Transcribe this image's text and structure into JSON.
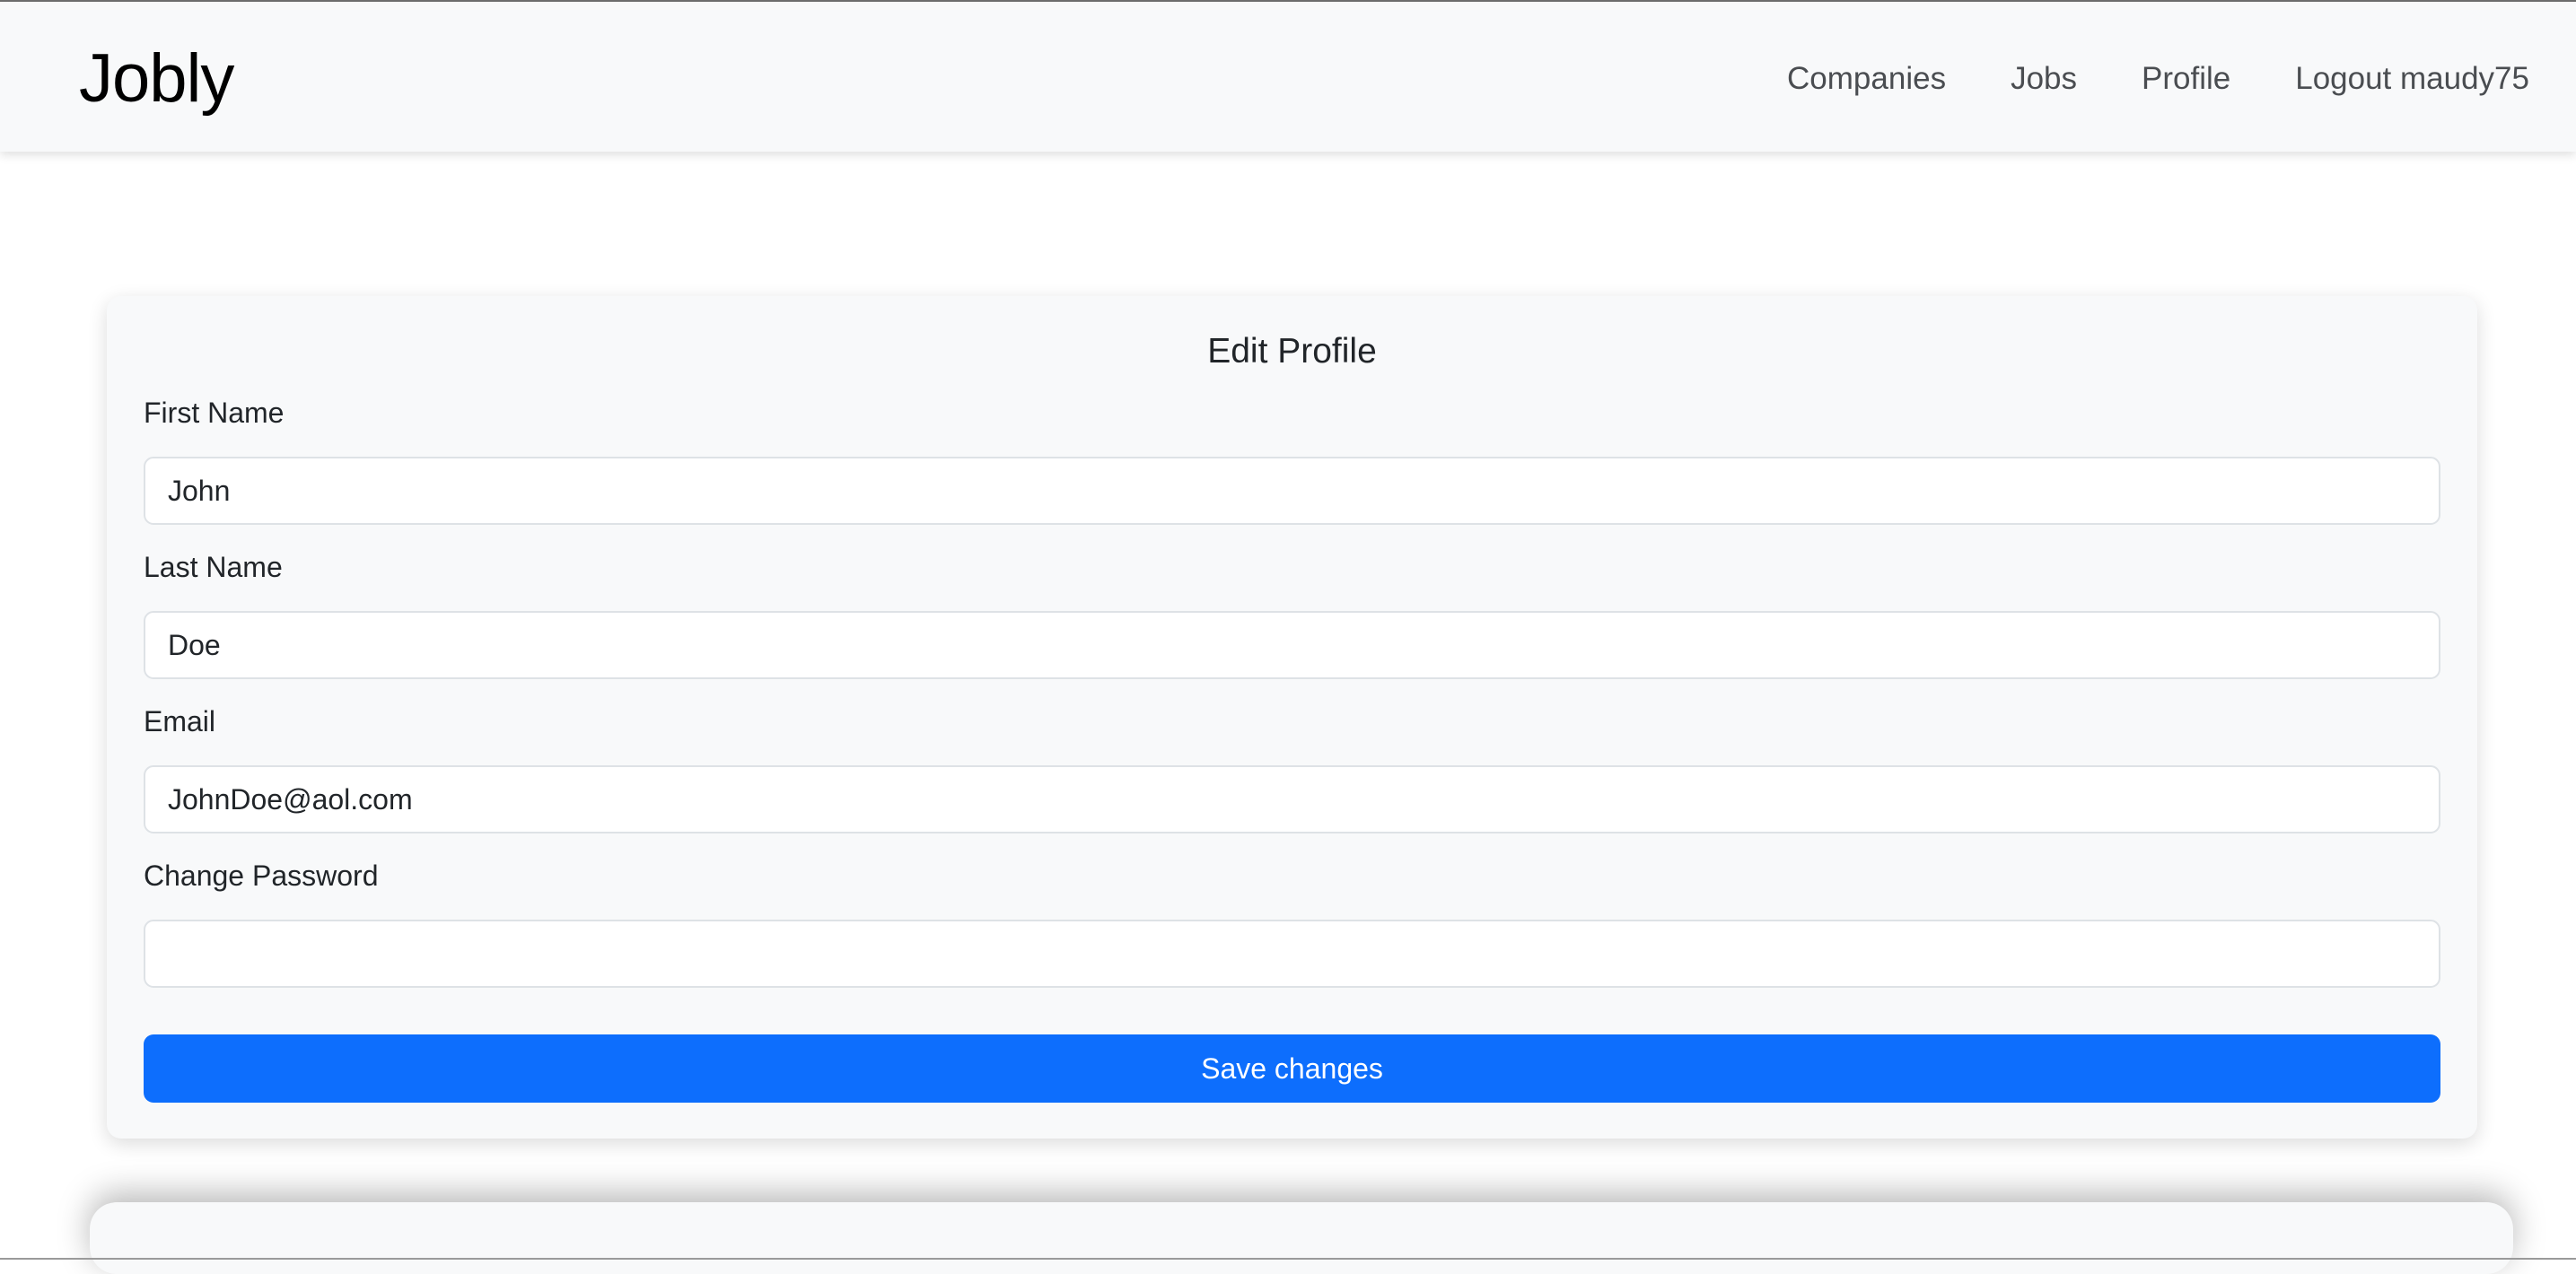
{
  "navbar": {
    "brand": "Jobly",
    "links": [
      {
        "label": "Companies"
      },
      {
        "label": "Jobs"
      },
      {
        "label": "Profile"
      },
      {
        "label": "Logout maudy75"
      }
    ]
  },
  "form": {
    "title": "Edit Profile",
    "first_name": {
      "label": "First Name",
      "value": "John"
    },
    "last_name": {
      "label": "Last Name",
      "value": "Doe"
    },
    "email": {
      "label": "Email",
      "value": "JohnDoe@aol.com"
    },
    "password": {
      "label": "Change Password",
      "value": ""
    },
    "submit_label": "Save changes"
  },
  "colors": {
    "navbar_bg": "#f8f9fa",
    "card_bg": "#f8f9fa",
    "primary": "#0d6efd",
    "text": "#212529",
    "nav_text": "#4a4d51"
  }
}
